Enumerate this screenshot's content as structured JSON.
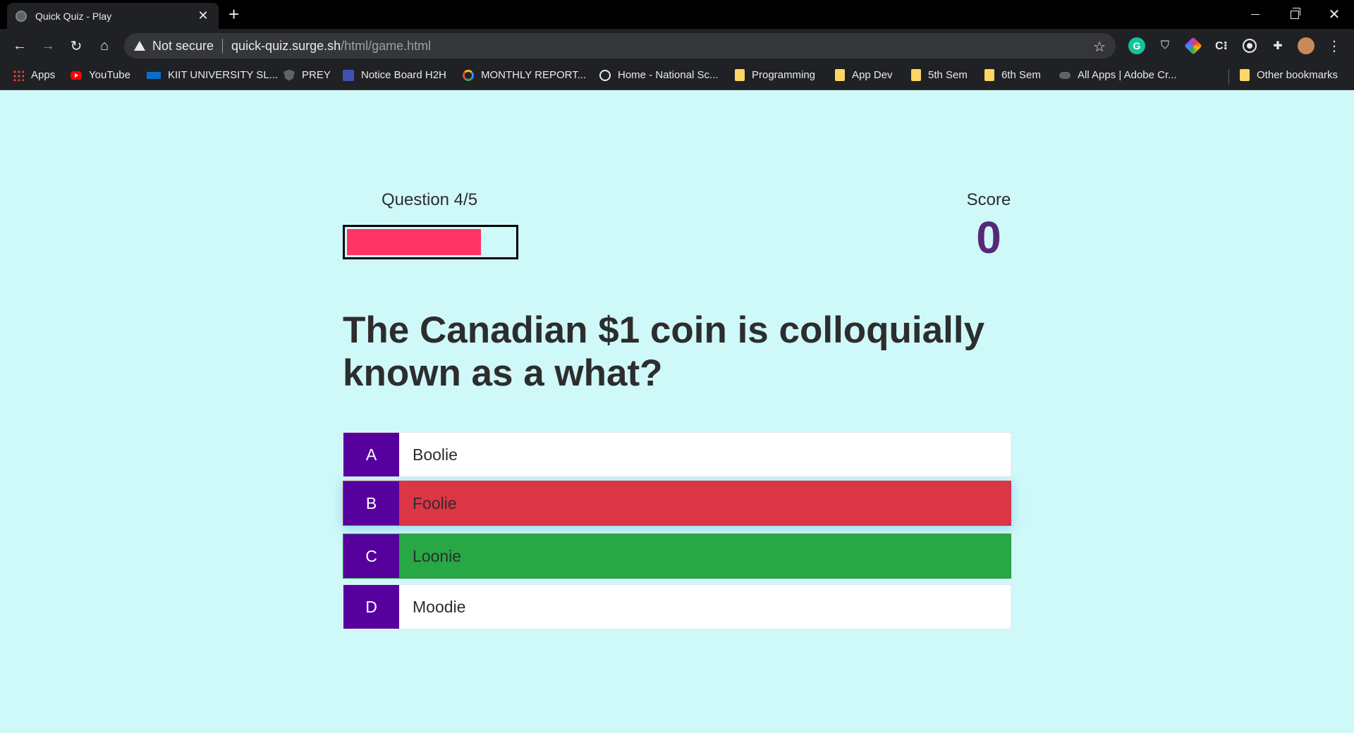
{
  "browser": {
    "tab": {
      "title": "Quick Quiz - Play",
      "close_glyph": "✕"
    },
    "new_tab_glyph": "+",
    "window_controls": {
      "min": "minimize-icon",
      "max": "restore-icon",
      "close": "✕"
    },
    "nav": {
      "back": "←",
      "forward": "→",
      "reload": "↻",
      "home": "⌂"
    },
    "address": {
      "security_label": "Not secure",
      "host": "quick-quiz.surge.sh",
      "path": "/html/game.html",
      "star_glyph": "☆"
    },
    "extensions": [
      {
        "name": "grammarly-icon",
        "glyph": "G"
      },
      {
        "name": "shield-extension-icon",
        "glyph": "⛉"
      },
      {
        "name": "colorful-extension-icon",
        "glyph": ""
      },
      {
        "name": "c-extension-icon",
        "glyph": "C⁝"
      },
      {
        "name": "target-extension-icon",
        "glyph": ""
      },
      {
        "name": "puzzle-extensions-icon",
        "glyph": "✚"
      },
      {
        "name": "profile-avatar",
        "glyph": ""
      },
      {
        "name": "menu-kebab-icon",
        "glyph": "⋮"
      }
    ],
    "bookmarks": [
      {
        "label": "Apps",
        "icon": "apps-grid-icon"
      },
      {
        "label": "YouTube",
        "icon": "youtube-icon"
      },
      {
        "label": "KIIT UNIVERSITY SL...",
        "icon": "sap-icon"
      },
      {
        "label": "PREY",
        "icon": "shield-icon"
      },
      {
        "label": "Notice Board H2H",
        "icon": "board-icon"
      },
      {
        "label": "MONTHLY REPORT...",
        "icon": "ring-icon"
      },
      {
        "label": "Home - National Sc...",
        "icon": "globe-icon"
      },
      {
        "label": "Programming",
        "icon": "folder-icon"
      },
      {
        "label": "App Dev",
        "icon": "folder-icon"
      },
      {
        "label": "5th Sem",
        "icon": "folder-icon"
      },
      {
        "label": "6th Sem",
        "icon": "folder-icon"
      },
      {
        "label": "All Apps | Adobe Cr...",
        "icon": "adobe-cloud-icon"
      },
      {
        "label": "Other bookmarks",
        "icon": "folder-icon"
      }
    ]
  },
  "quiz": {
    "progress_label": "Question 4/5",
    "progress_fraction": 0.8,
    "score_label": "Score",
    "score": "0",
    "question": "The Canadian $1 coin is colloquially known as a what?",
    "choices": [
      {
        "prefix": "A",
        "text": "Boolie",
        "state": "default"
      },
      {
        "prefix": "B",
        "text": "Foolie",
        "state": "incorrect"
      },
      {
        "prefix": "C",
        "text": "Loonie",
        "state": "correct"
      },
      {
        "prefix": "D",
        "text": "Moodie",
        "state": "default"
      }
    ],
    "colors": {
      "background": "#cff8f9",
      "progress_fill": "#ff3366",
      "score": "#56287a",
      "prefix": "#56009e",
      "incorrect": "#dc3545",
      "correct": "#28a745"
    }
  }
}
